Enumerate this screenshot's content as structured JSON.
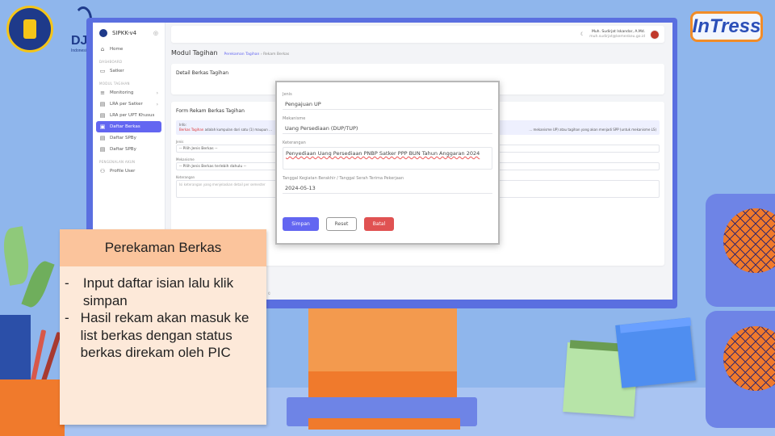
{
  "sidebar": {
    "brand": "SIPKK-v4",
    "items": [
      {
        "label": "Home",
        "icon": "home-icon"
      },
      {
        "section": "DASHBOARD"
      },
      {
        "label": "Satker",
        "icon": "monitor-icon"
      },
      {
        "section": "MODUL TAGIHAN"
      },
      {
        "label": "Monitoring",
        "icon": "list-icon",
        "chevron": true
      },
      {
        "label": "LRA per Satker",
        "icon": "doc-icon",
        "chevron": true
      },
      {
        "label": "LRA per UPT Khusus",
        "icon": "doc-icon"
      },
      {
        "label": "Daftar Berkas",
        "icon": "folder-icon",
        "active": true
      },
      {
        "label": "Daftar SPBy",
        "icon": "doc-icon"
      },
      {
        "label": "Daftar SPBy",
        "icon": "doc-icon"
      },
      {
        "section": "PENGENALAN AKUN"
      },
      {
        "label": "Profile User",
        "icon": "user-icon"
      }
    ]
  },
  "topbar": {
    "user_name": "Muh. Sudirjat Iskandar, A.Md.",
    "user_email": "muh.sudirjat@kemenkeu.go.id"
  },
  "page": {
    "title": "Modul Tagihan",
    "breadcrumb_link": "Perekaman Tagihan",
    "breadcrumb_current": "Rekam Berkas"
  },
  "detail_card": {
    "title": "Detail Berkas Tagihan"
  },
  "form_card": {
    "title": "Form Rekam Berkas Tagihan",
    "info_label": "Info:",
    "info_red": "Berkas Tagihan",
    "info_text": "adalah kumpulan dari satu (1) maupun ...",
    "info_tail": "... mekanisme UP) atau tagihan yang akan menjadi SPP (untuk mekanisme LS)",
    "jenis_label": "Jenis",
    "jenis_value": "-- Pilih Jenis Berkas --",
    "mekanisme_label": "Mekanisme",
    "mekanisme_value": "-- Pilih Jenis Berkas terlebih dahulu --",
    "keterangan_label": "Keterangan",
    "keterangan_placeholder": "Isi keterangan yang menjelaskan detail per semester",
    "footer_text": "2024 ©"
  },
  "modal": {
    "jenis_label": "Jenis",
    "jenis_value": "Pengajuan UP",
    "mekanisme_label": "Mekanisme",
    "mekanisme_value": "Uang Persediaan (DUP/TUP)",
    "keterangan_label": "Keterangan",
    "keterangan_value": "Penyediaan Uang Persediaan PNBP Satker PPP BUN Tahun Anggaran 2024",
    "tanggal_label": "Tanggal Kegiatan Berakhir / Tanggal Serah Terima Pekerjaan",
    "tanggal_value": "2024-05-13",
    "btn_save": "Simpan",
    "btn_reset": "Reset",
    "btn_cancel": "Batal"
  },
  "note": {
    "heading": "Perekaman Berkas",
    "bullets": [
      "Input daftar isian lalu klik simpan",
      "Hasil rekam akan masuk ke list berkas dengan status berkas direkam oleh PIC"
    ]
  },
  "logos": {
    "dj_text": "DJ",
    "dj_sub": "Indonesia",
    "intress": "InTress"
  },
  "colors": {
    "primary": "#6366f1",
    "danger": "#e05252",
    "monitor": "#5a6fe0",
    "note_head": "#fbc49c"
  }
}
